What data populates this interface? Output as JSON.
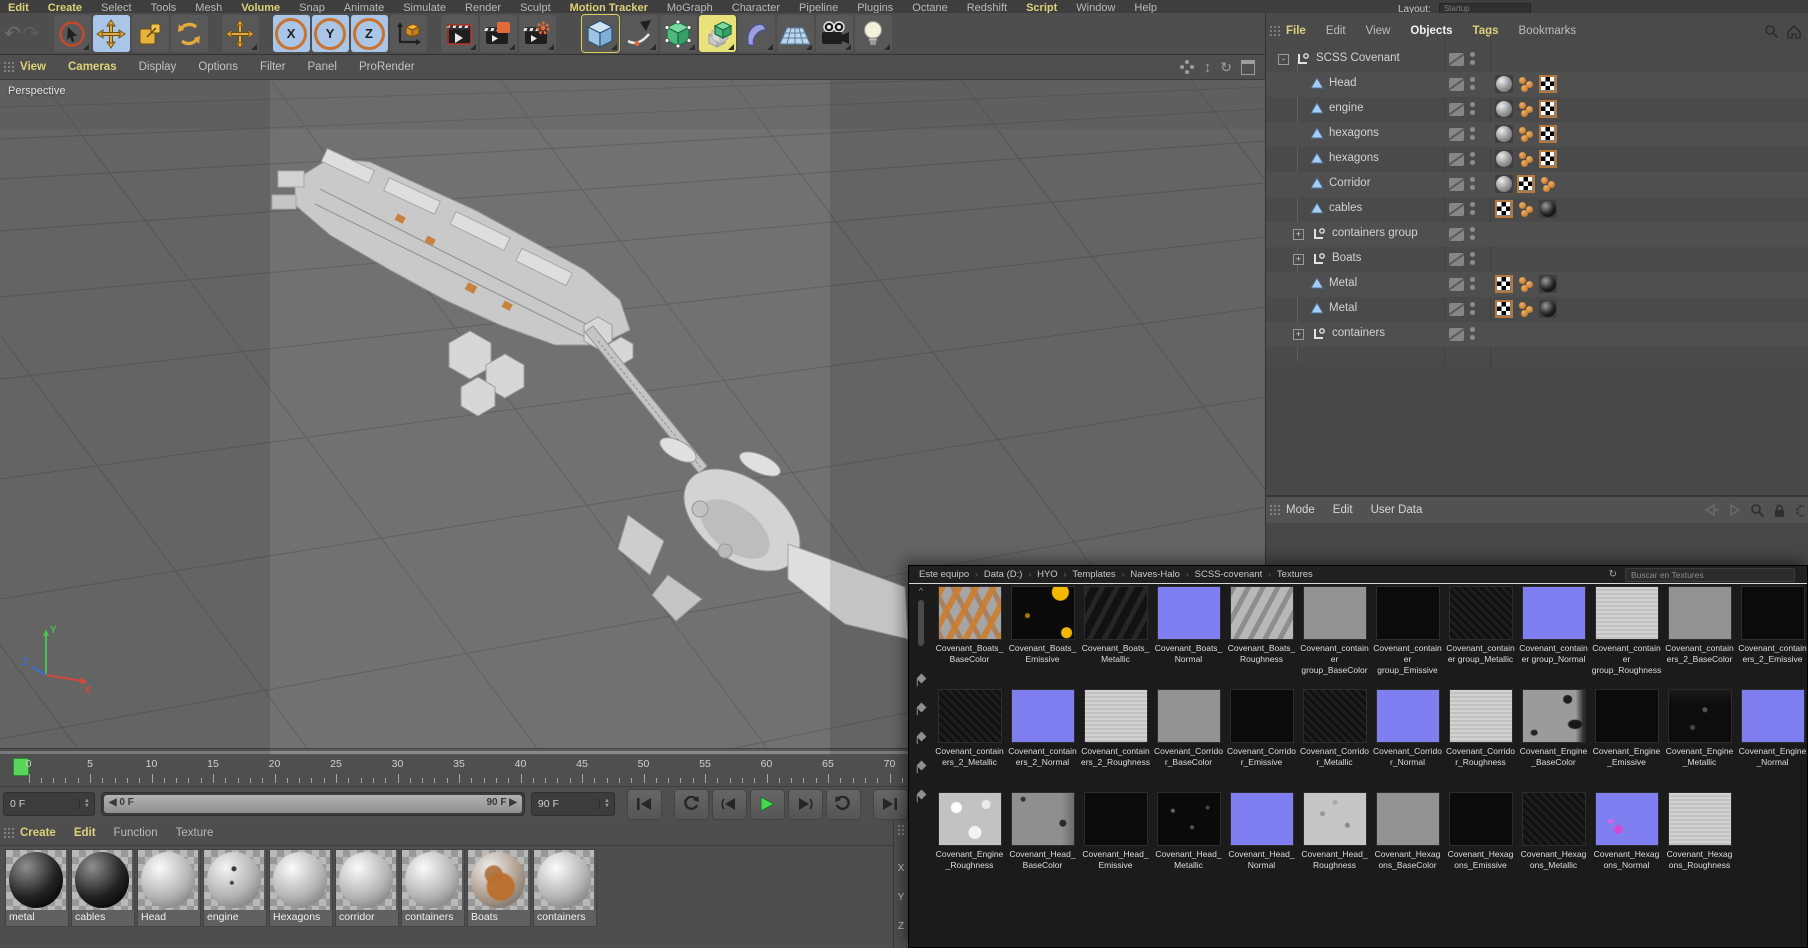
{
  "colors": {
    "accent_yellow": "#ddd27a",
    "active_blue": "#a9c6e8",
    "active_yellow": "#e9e27b",
    "play_green": "#4ad14a",
    "playhead_green": "#58d65a",
    "normal_map_blue": "#7f7ff2",
    "tag_orange": "#b5793d",
    "panel_gray": "#4e4e4e"
  },
  "icons": {
    "undo": "↶",
    "redo": "↷",
    "refresh": "↻",
    "rotate": "↻",
    "dolly": "↕",
    "chevron_up": "^",
    "crumb_sep": "›"
  },
  "menubar": {
    "items": [
      {
        "label": "Edit",
        "hl": true
      },
      {
        "label": "Create",
        "hl": true
      },
      {
        "label": "Select",
        "hl": false
      },
      {
        "label": "Tools",
        "hl": false
      },
      {
        "label": "Mesh",
        "hl": false
      },
      {
        "label": "Volume",
        "hl": true
      },
      {
        "label": "Snap",
        "hl": false
      },
      {
        "label": "Animate",
        "hl": false
      },
      {
        "label": "Simulate",
        "hl": false
      },
      {
        "label": "Render",
        "hl": false
      },
      {
        "label": "Sculpt",
        "hl": false
      },
      {
        "label": "Motion Tracker",
        "hl": true
      },
      {
        "label": "MoGraph",
        "hl": false
      },
      {
        "label": "Character",
        "hl": false
      },
      {
        "label": "Pipeline",
        "hl": false
      },
      {
        "label": "Plugins",
        "hl": false
      },
      {
        "label": "Octane",
        "hl": false
      },
      {
        "label": "Redshift",
        "hl": false
      },
      {
        "label": "Script",
        "hl": true
      },
      {
        "label": "Window",
        "hl": false
      },
      {
        "label": "Help",
        "hl": false
      }
    ],
    "layout_label": "Layout:",
    "layout_value": "Startup"
  },
  "toolbar": {
    "axis_locks": [
      "X",
      "Y",
      "Z"
    ]
  },
  "viewport": {
    "camera_label": "Perspective",
    "menu": [
      {
        "label": "View",
        "hl": true
      },
      {
        "label": "Cameras",
        "hl": true
      },
      {
        "label": "Display",
        "hl": false
      },
      {
        "label": "Options",
        "hl": false
      },
      {
        "label": "Filter",
        "hl": false
      },
      {
        "label": "Panel",
        "hl": false
      },
      {
        "label": "ProRender",
        "hl": false
      }
    ],
    "axis_labels": {
      "x": "X",
      "y": "Y",
      "z": "Z"
    }
  },
  "object_manager": {
    "menu": [
      {
        "label": "File",
        "tone": "yellow"
      },
      {
        "label": "Edit",
        "tone": "gray"
      },
      {
        "label": "View",
        "tone": "gray"
      },
      {
        "label": "Objects",
        "tone": "bright"
      },
      {
        "label": "Tags",
        "tone": "yellow"
      },
      {
        "label": "Bookmarks",
        "tone": "gray"
      }
    ],
    "rows": [
      {
        "label": "SCSS Covenant",
        "type": "null",
        "kind": "root",
        "expand": "-",
        "tags": []
      },
      {
        "label": "Head",
        "type": "poly",
        "kind": "child",
        "expand": null,
        "tags": [
          "mat-gray",
          "phong",
          "uvw"
        ]
      },
      {
        "label": "engine",
        "type": "poly",
        "kind": "child",
        "expand": null,
        "tags": [
          "mat-gray",
          "phong",
          "uvw"
        ]
      },
      {
        "label": "hexagons",
        "type": "poly",
        "kind": "child",
        "expand": null,
        "tags": [
          "mat-gray",
          "phong",
          "uvw"
        ]
      },
      {
        "label": "hexagons",
        "type": "poly",
        "kind": "child",
        "expand": null,
        "tags": [
          "mat-gray",
          "phong",
          "uvw"
        ]
      },
      {
        "label": "Corridor",
        "type": "poly",
        "kind": "child",
        "expand": null,
        "tags": [
          "mat-gray",
          "uvw",
          "phong"
        ]
      },
      {
        "label": "cables",
        "type": "poly",
        "kind": "child",
        "expand": null,
        "tags": [
          "uvw",
          "phong",
          "mat-black"
        ]
      },
      {
        "label": "containers group",
        "type": "null",
        "kind": "group",
        "expand": "+",
        "tags": []
      },
      {
        "label": "Boats",
        "type": "null",
        "kind": "group",
        "expand": "+",
        "tags": []
      },
      {
        "label": "Metal",
        "type": "poly",
        "kind": "child",
        "expand": null,
        "tags": [
          "uvw",
          "phong",
          "mat-black"
        ]
      },
      {
        "label": "Metal",
        "type": "poly",
        "kind": "child",
        "expand": null,
        "tags": [
          "uvw",
          "phong",
          "mat-black"
        ]
      },
      {
        "label": "containers",
        "type": "null",
        "kind": "group",
        "expand": "+",
        "tags": []
      }
    ]
  },
  "attribute_manager": {
    "menu": [
      "Mode",
      "Edit",
      "User Data"
    ]
  },
  "timeline": {
    "ticks": [
      0,
      5,
      10,
      15,
      20,
      25,
      30,
      35,
      40,
      45,
      50,
      55,
      60,
      65,
      70
    ],
    "current_frame": "0 F",
    "range_start": "0 F",
    "range_end": "90 F",
    "end_frame": "90 F"
  },
  "materials": {
    "menu": [
      {
        "label": "Create",
        "hl": true
      },
      {
        "label": "Edit",
        "hl": true
      },
      {
        "label": "Function",
        "hl": false
      },
      {
        "label": "Texture",
        "hl": false
      }
    ],
    "items": [
      {
        "name": "metal",
        "style": "black"
      },
      {
        "name": "cables",
        "style": "black"
      },
      {
        "name": "Head",
        "style": "gray"
      },
      {
        "name": "engine",
        "style": "graym"
      },
      {
        "name": "Hexagons",
        "style": "gray"
      },
      {
        "name": "corridor",
        "style": "gray"
      },
      {
        "name": "containers",
        "style": "gray"
      },
      {
        "name": "Boats",
        "style": "boats"
      },
      {
        "name": "containers",
        "style": "gray"
      }
    ]
  },
  "coord_strip": [
    "X",
    "Y",
    "Z"
  ],
  "explorer": {
    "breadcrumbs": [
      "Este equipo",
      "Data (D:)",
      "HYO",
      "Templates",
      "Naves-Halo",
      "SCSS-covenant",
      "Textures"
    ],
    "search_placeholder": "Buscar en Textures",
    "rows": [
      [
        {
          "name": "Covenant_Boats_BaseColor",
          "style": "boats_base"
        },
        {
          "name": "Covenant_Boats_Emissive",
          "style": "boats_emissive"
        },
        {
          "name": "Covenant_Boats_Metallic",
          "style": "boats_metal"
        },
        {
          "name": "Covenant_Boats_Normal",
          "style": "normal"
        },
        {
          "name": "Covenant_Boats_Roughness",
          "style": "boats_rough"
        },
        {
          "name": "Covenant_container group_BaseColor",
          "style": "base"
        },
        {
          "name": "Covenant_container group_Emissive",
          "style": "emissive"
        },
        {
          "name": "Covenant_container group_Metallic",
          "style": "metal_dark"
        },
        {
          "name": "Covenant_container group_Normal",
          "style": "normal"
        },
        {
          "name": "Covenant_container group_Roughness",
          "style": "rough"
        },
        {
          "name": "Covenant_containers_2_BaseColor",
          "style": "base"
        },
        {
          "name": "Covenant_containers_2_Emissive",
          "style": "emissive"
        }
      ],
      [
        {
          "name": "Covenant_containers_2_Metallic",
          "style": "metal_dark"
        },
        {
          "name": "Covenant_containers_2_Normal",
          "style": "normal"
        },
        {
          "name": "Covenant_containers_2_Roughness",
          "style": "rough"
        },
        {
          "name": "Covenant_Corridor_BaseColor",
          "style": "base"
        },
        {
          "name": "Covenant_Corridor_Emissive",
          "style": "emissive"
        },
        {
          "name": "Covenant_Corridor_Metallic",
          "style": "metal_dark"
        },
        {
          "name": "Covenant_Corridor_Normal",
          "style": "normal"
        },
        {
          "name": "Covenant_Corridor_Roughness",
          "style": "rough"
        },
        {
          "name": "Covenant_Engine_BaseColor",
          "style": "engine_base"
        },
        {
          "name": "Covenant_Engine_Emissive",
          "style": "emissive"
        },
        {
          "name": "Covenant_Engine_Metallic",
          "style": "engine_metal"
        },
        {
          "name": "Covenant_Engine_Normal",
          "style": "normal"
        }
      ],
      [
        {
          "name": "Covenant_Engine_Roughness",
          "style": "engine_rough"
        },
        {
          "name": "Covenant_Head_BaseColor",
          "style": "head_base"
        },
        {
          "name": "Covenant_Head_Emissive",
          "style": "emissive"
        },
        {
          "name": "Covenant_Head_Metallic",
          "style": "head_metal"
        },
        {
          "name": "Covenant_Head_Normal",
          "style": "normal"
        },
        {
          "name": "Covenant_Head_Roughness",
          "style": "head_rough"
        },
        {
          "name": "Covenant_Hexagons_BaseColor",
          "style": "base"
        },
        {
          "name": "Covenant_Hexagons_Emissive",
          "style": "emissive"
        },
        {
          "name": "Covenant_Hexagons_Metallic",
          "style": "metal_dark"
        },
        {
          "name": "Covenant_Hexagons_Normal",
          "style": "hex_normal"
        },
        {
          "name": "Covenant_Hexagons_Roughness",
          "style": "rough"
        }
      ]
    ]
  }
}
